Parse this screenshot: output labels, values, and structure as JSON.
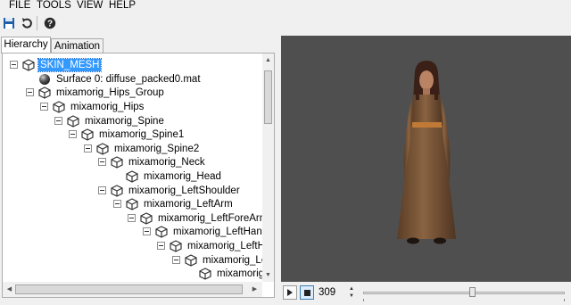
{
  "menu": {
    "file": "FILE",
    "tools": "TOOLS",
    "view": "VIEW",
    "help": "HELP"
  },
  "toolbar": {
    "save_icon": "floppy-disk-icon",
    "rotate_icon": "rotate-arrow-icon",
    "help_icon": "question-mark-icon"
  },
  "tabs": [
    {
      "label": "Hierarchy",
      "active": true
    },
    {
      "label": "Animation",
      "active": false
    }
  ],
  "tree": {
    "nodes": [
      {
        "label": "SKIN_MESH",
        "icon": "cube",
        "selected": true
      },
      {
        "label": "Surface 0: diffuse_packed0.mat",
        "icon": "sphere"
      },
      {
        "label": "mixamorig_Hips_Group",
        "icon": "cube"
      },
      {
        "label": "mixamorig_Hips",
        "icon": "cube"
      },
      {
        "label": "mixamorig_Spine",
        "icon": "cube"
      },
      {
        "label": "mixamorig_Spine1",
        "icon": "cube"
      },
      {
        "label": "mixamorig_Spine2",
        "icon": "cube"
      },
      {
        "label": "mixamorig_Neck",
        "icon": "cube"
      },
      {
        "label": "mixamorig_Head",
        "icon": "cube"
      },
      {
        "label": "mixamorig_LeftShoulder",
        "icon": "cube"
      },
      {
        "label": "mixamorig_LeftArm",
        "icon": "cube"
      },
      {
        "label": "mixamorig_LeftForeArm",
        "icon": "cube"
      },
      {
        "label": "mixamorig_LeftHand",
        "icon": "cube"
      },
      {
        "label": "mixamorig_LeftHa",
        "icon": "cube"
      },
      {
        "label": "mixamorig_Lef",
        "icon": "cube"
      },
      {
        "label": "mixamorig_",
        "icon": "cube"
      }
    ]
  },
  "viewport": {
    "subject": "3D character model in long brown dress",
    "background_color": "#4f4f4f"
  },
  "playback": {
    "play_icon": "play-icon",
    "stop_icon": "stop-icon",
    "frame": "309",
    "timeline_position": 0.54
  },
  "colors": {
    "selection": "#3399ff",
    "save_icon": "#1f5fa8",
    "dress": "#7a5535"
  }
}
